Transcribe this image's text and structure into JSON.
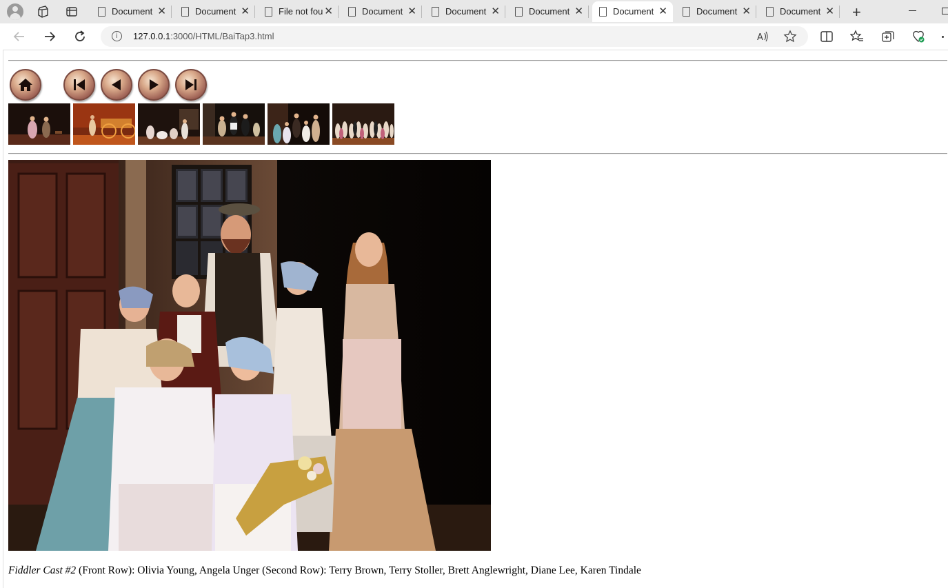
{
  "browser": {
    "tabs": [
      {
        "title": "Document",
        "active": false
      },
      {
        "title": "Document",
        "active": false
      },
      {
        "title": "File not found",
        "active": false
      },
      {
        "title": "Document",
        "active": false
      },
      {
        "title": "Document",
        "active": false
      },
      {
        "title": "Document",
        "active": false
      },
      {
        "title": "Document",
        "active": true
      },
      {
        "title": "Document",
        "active": false
      },
      {
        "title": "Document",
        "active": false
      }
    ],
    "close_glyph": "✕",
    "new_tab_glyph": "+",
    "address": {
      "host": "127.0.0.1",
      "rest": ":3000/HTML/BaiTap3.html"
    }
  },
  "page": {
    "nav_buttons": [
      {
        "name": "home-button",
        "icon": "home-icon"
      },
      {
        "name": "first-button",
        "icon": "skip-first-icon"
      },
      {
        "name": "previous-button",
        "icon": "previous-icon"
      },
      {
        "name": "next-button",
        "icon": "next-icon"
      },
      {
        "name": "last-button",
        "icon": "skip-last-icon"
      }
    ],
    "thumbnails_count_label": "",
    "caption": {
      "title": "Fiddler Cast #2",
      "text": " (Front Row): Olivia Young, Angela Unger (Second Row): Terry Brown, Terry Stoller, Brett Anglewright, Diane Lee, Karen Tindale"
    }
  },
  "colors": {
    "button_rim": "#7b4a40",
    "button_face": "#d9a98a",
    "tab_active": "#ffffff",
    "tabbar_bg": "#e8e8e8"
  }
}
